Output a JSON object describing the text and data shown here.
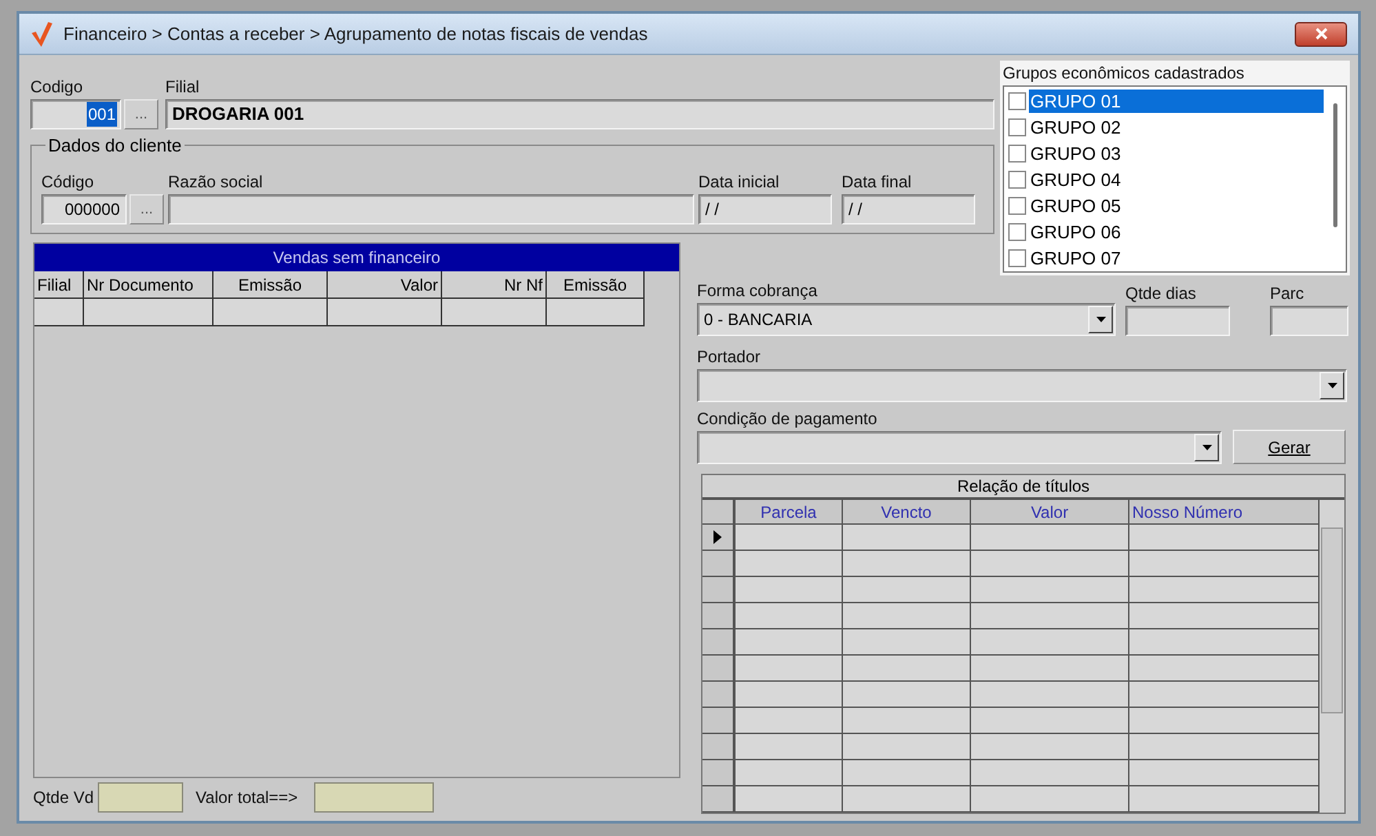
{
  "window": {
    "title": "Financeiro > Contas a receber > Agrupamento de notas fiscais de vendas"
  },
  "codigo": {
    "label": "Codigo",
    "value": "001",
    "selected": true,
    "lookup": "..."
  },
  "filial": {
    "label": "Filial",
    "value": "DROGARIA 001"
  },
  "dados_do_cliente": {
    "title": "Dados do cliente",
    "codigo": {
      "label": "Código",
      "value": "000000",
      "lookup": "..."
    },
    "razao_social": {
      "label": "Razão social"
    },
    "data_inicial": {
      "label": "Data inicial",
      "value": "/ /"
    },
    "data_final": {
      "label": "Data final",
      "value": "/ /"
    }
  },
  "grupos": {
    "title": "Grupos econômicos cadastrados",
    "items": [
      {
        "label": "GRUPO 01",
        "checked": false,
        "selected": true
      },
      {
        "label": "GRUPO 02",
        "checked": false,
        "selected": false
      },
      {
        "label": "GRUPO 03",
        "checked": false,
        "selected": false
      },
      {
        "label": "GRUPO 04",
        "checked": false,
        "selected": false
      },
      {
        "label": "GRUPO 05",
        "checked": false,
        "selected": false
      },
      {
        "label": "GRUPO 06",
        "checked": false,
        "selected": false
      },
      {
        "label": "GRUPO 07",
        "checked": false,
        "selected": false
      }
    ]
  },
  "vendas": {
    "title": "Vendas sem financeiro",
    "columns": [
      "Filial",
      "Nr Documento",
      "Emissão",
      "Valor",
      "Nr Nf",
      "Emissão"
    ]
  },
  "footer": {
    "qtde_vd": {
      "label": "Qtde Vd"
    },
    "valor_total": {
      "label": "Valor total==>"
    }
  },
  "forma_cobranca": {
    "label": "Forma cobrança",
    "value": "0 - BANCARIA"
  },
  "qtde_dias": {
    "label": "Qtde dias"
  },
  "parc": {
    "label": "Parc"
  },
  "portador": {
    "label": "Portador"
  },
  "condicao_pagamento": {
    "label": "Condição de pagamento"
  },
  "gerar_button": {
    "label": "Gerar"
  },
  "titulos": {
    "title": "Relação de títulos",
    "columns": [
      "Parcela",
      "Vencto",
      "Valor",
      "Nosso Número"
    ],
    "rows": [
      {
        "selected": true
      },
      {
        "selected": false
      },
      {
        "selected": false
      },
      {
        "selected": false
      },
      {
        "selected": false
      },
      {
        "selected": false
      },
      {
        "selected": false
      },
      {
        "selected": false
      },
      {
        "selected": false
      },
      {
        "selected": false
      },
      {
        "selected": false
      }
    ]
  }
}
